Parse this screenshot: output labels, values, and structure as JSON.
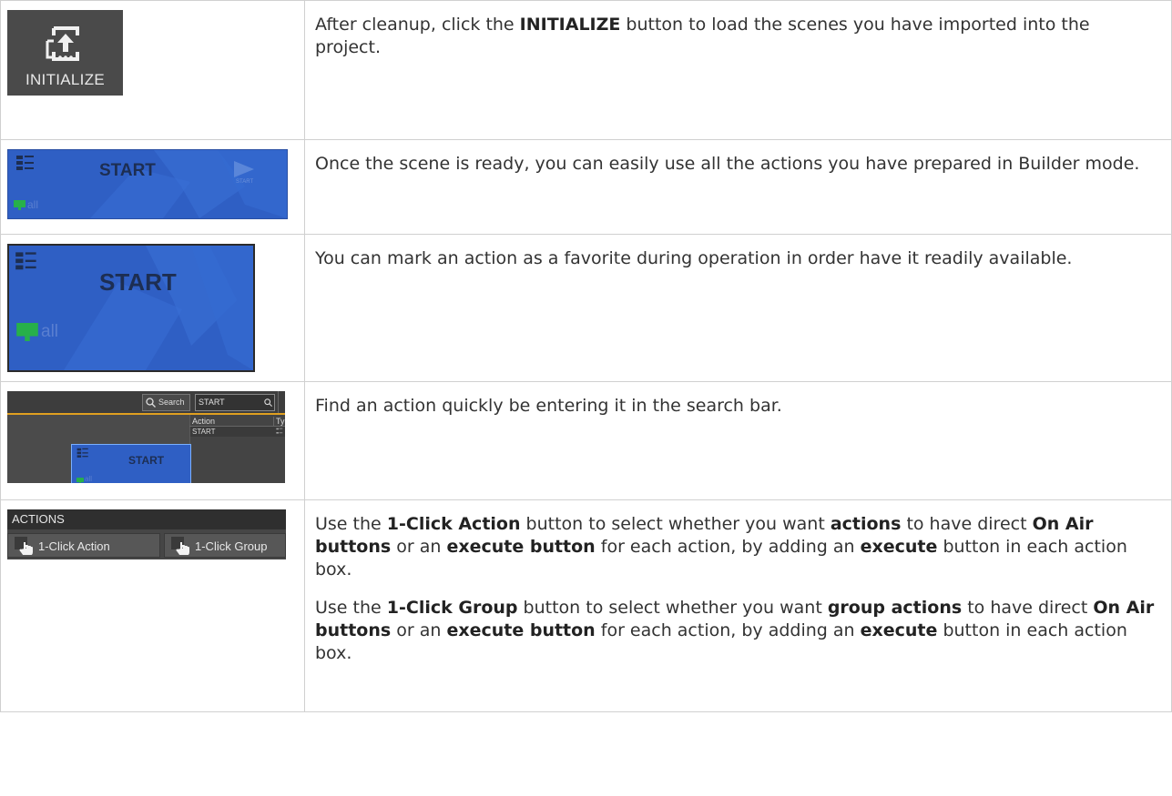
{
  "rows": [
    {
      "image_label": "INITIALIZE",
      "paragraphs": [
        [
          "After cleanup, click the ",
          {
            "b": "INITIALIZE"
          },
          " button to load the scenes you have imported into the project."
        ]
      ]
    },
    {
      "image_title": "START",
      "image_badge": "all",
      "image_play_label": "START",
      "paragraphs": [
        [
          "Once the scene is ready, you can easily use all the actions you have prepared in Builder mode."
        ]
      ]
    },
    {
      "image_title": "START",
      "image_badge": "all",
      "paragraphs": [
        [
          "You can mark an action as a favorite during operation in order have it readily available."
        ]
      ]
    },
    {
      "search_label": "Search",
      "search_value": "START",
      "col_action": "Action",
      "col_type": "Typ",
      "result": "START",
      "image_title": "START",
      "image_badge": "all",
      "paragraphs": [
        [
          "Find an action quickly be entering it in the search bar."
        ]
      ]
    },
    {
      "panel_header": "ACTIONS",
      "btn_action": "1-Click Action",
      "btn_group": "1-Click Group",
      "paragraphs": [
        [
          "Use the ",
          {
            "b": "1-Click Action"
          },
          " button to select whether you want ",
          {
            "b": "actions"
          },
          " to have direct ",
          {
            "b": "On Air buttons"
          },
          " or an ",
          {
            "b": "execute button"
          },
          " for each action, by adding an ",
          {
            "b": "execute"
          },
          " button in each action box."
        ],
        [
          "Use the ",
          {
            "b": "1-Click Group"
          },
          " button to select whether you want ",
          {
            "b": "group actions"
          },
          " to have direct ",
          {
            "b": "On Air buttons"
          },
          " or an ",
          {
            "b": "execute button"
          },
          " for each action, by adding an ",
          {
            "b": "execute"
          },
          " button in each action box."
        ]
      ]
    }
  ]
}
